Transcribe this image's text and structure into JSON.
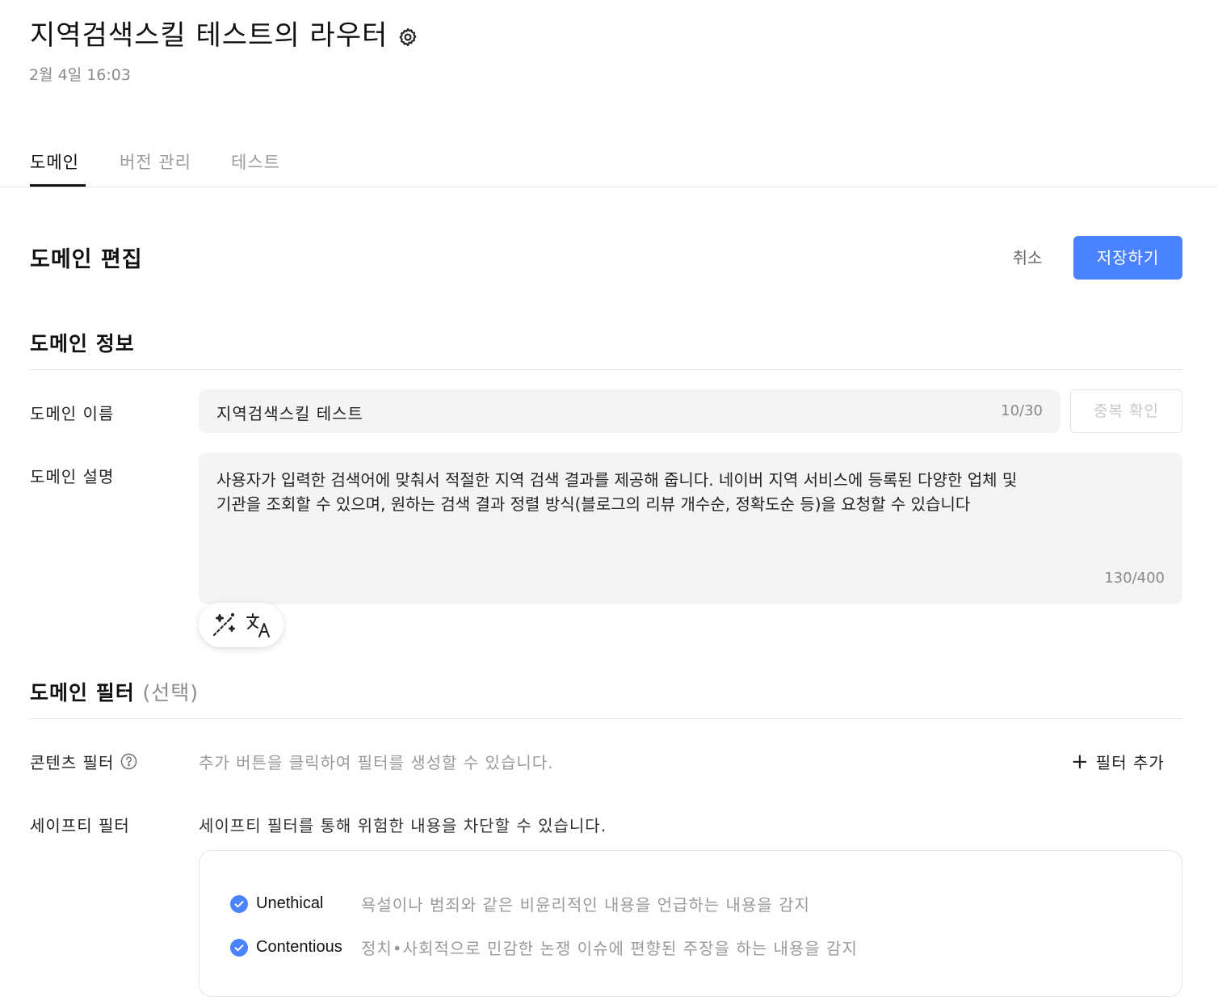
{
  "header": {
    "title": "지역검색스킬 테스트의 라우터",
    "timestamp": "2월 4일 16:03",
    "settings_icon": "gear-icon"
  },
  "tabs": [
    {
      "label": "도메인",
      "active": true
    },
    {
      "label": "버전 관리",
      "active": false
    },
    {
      "label": "테스트",
      "active": false
    }
  ],
  "edit": {
    "title": "도메인 편집",
    "cancel_label": "취소",
    "save_label": "저장하기"
  },
  "domain_info": {
    "title": "도메인 정보",
    "name_label": "도메인 이름",
    "name_value": "지역검색스킬 테스트",
    "name_counter": "10/30",
    "dup_check_label": "중복 확인",
    "desc_label": "도메인 설명",
    "desc_value": "사용자가 입력한 검색어에 맞춰서 적절한 지역 검색 결과를 제공해 줍니다. 네이버 지역 서비스에 등록된 다양한 업체 및 기관을 조회할 수 있으며, 원하는 검색 결과 정렬 방식(블로그의 리뷰 개수순, 정확도순 등)을 요청할 수 있습니다",
    "desc_counter": "130/400",
    "tools": [
      "magic-wand-icon",
      "translate-icon"
    ]
  },
  "domain_filter": {
    "title": "도메인 필터",
    "title_optional": "(선택)",
    "content_filter_label": "콘텐츠 필터",
    "content_filter_hint": "추가 버튼을 클릭하여 필터를 생성할 수 있습니다.",
    "add_filter_label": "필터 추가",
    "safety_filter_label": "세이프티 필터",
    "safety_filter_desc": "세이프티 필터를 통해 위험한 내용을 차단할 수 있습니다.",
    "safety_items": [
      {
        "name": "Unethical",
        "desc": "욕설이나 범죄와 같은 비윤리적인 내용을 언급하는 내용을 감지",
        "checked": true
      },
      {
        "name": "Contentious",
        "desc": "정치•사회적으로 민감한 논쟁 이슈에 편향된 주장을 하는 내용을 감지",
        "checked": true
      }
    ]
  },
  "colors": {
    "accent": "#4a83ff",
    "text": "#111111",
    "muted": "#9a9a9a",
    "field_bg": "#f4f4f4"
  }
}
